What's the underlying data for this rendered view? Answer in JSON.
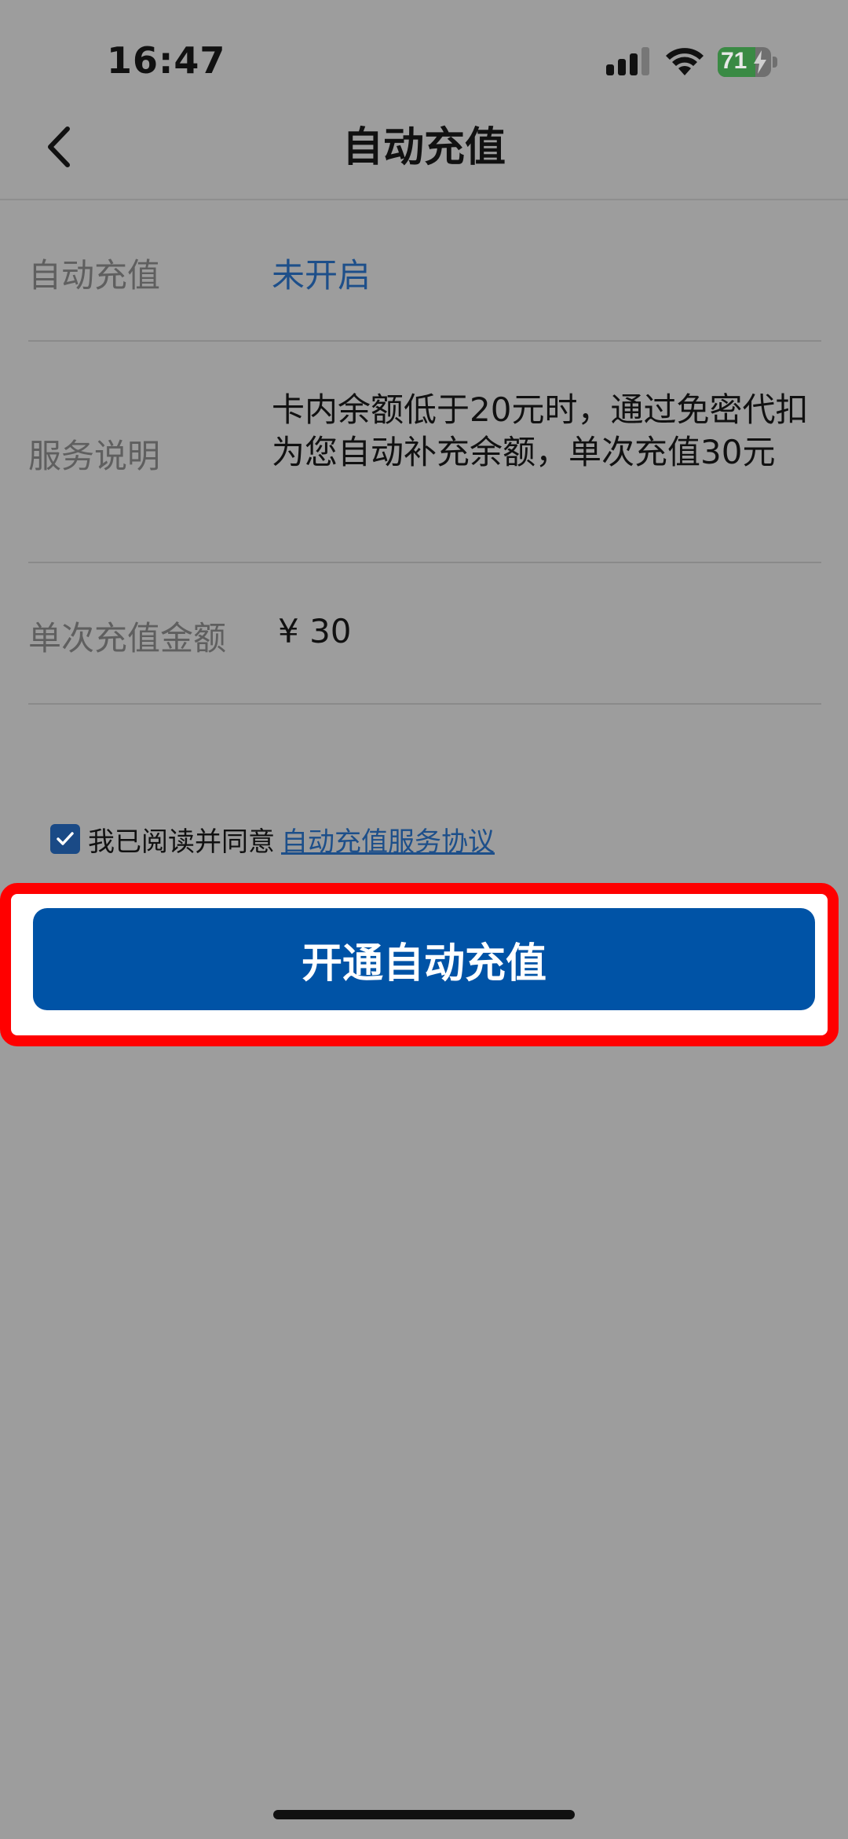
{
  "status_bar": {
    "time": "16:47",
    "battery_level": "71",
    "battery_fraction": 0.71,
    "icons": [
      "signal-icon",
      "wifi-icon",
      "battery-icon"
    ]
  },
  "nav": {
    "title": "自动充值",
    "back_icon": "chevron-left-icon"
  },
  "rows": [
    {
      "label": "自动充值",
      "value": "未开启"
    },
    {
      "label": "服务说明",
      "value": "卡内余额低于20元时，通过免密代扣为您自动补充余额，单次充值30元"
    },
    {
      "label": "单次充值金额",
      "value": "¥ 30"
    }
  ],
  "agreement": {
    "checked": true,
    "text": "我已阅读并同意",
    "link": "自动充值服务协议"
  },
  "action": {
    "button_label": "开通自动充值"
  },
  "colors": {
    "background": "#9d9d9d",
    "primary": "#0053a6",
    "status_text": "#1d4f8a",
    "highlight": "#ff0000"
  }
}
